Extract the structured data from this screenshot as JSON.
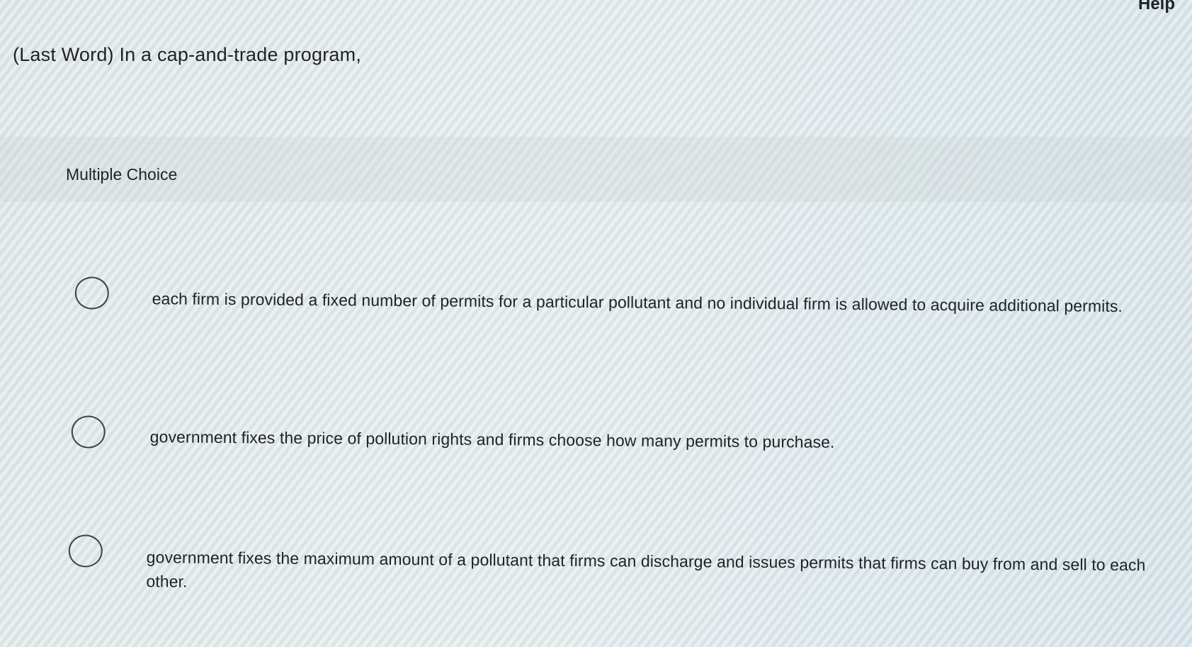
{
  "header": {
    "help_label": "Help"
  },
  "question": {
    "title": "(Last Word) In a cap-and-trade program,",
    "type_label": "Multiple Choice"
  },
  "choices": [
    {
      "text": "each firm is provided a fixed number of permits for a particular pollutant and no individual firm is allowed to acquire additional permits.",
      "selected": false
    },
    {
      "text": "government fixes the price of pollution rights and firms choose how many permits to purchase.",
      "selected": false
    },
    {
      "text": "government fixes the maximum amount of a pollutant that firms can discharge and issues permits that firms can buy from and sell to each other.",
      "selected": false
    }
  ],
  "icons": {
    "radio": "radio-unselected-icon"
  }
}
